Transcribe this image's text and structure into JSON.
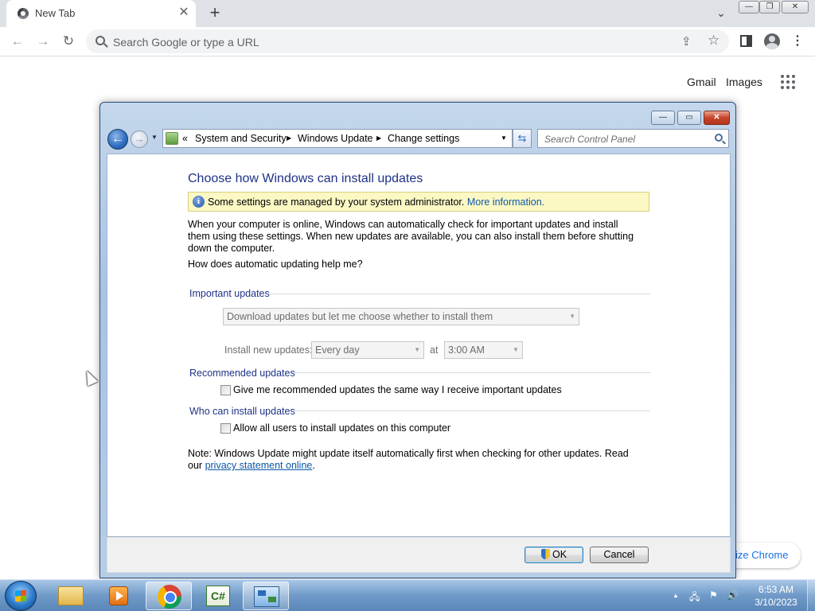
{
  "browser": {
    "tab_title": "New Tab",
    "tab_close": "✕",
    "new_tab": "+",
    "tab_search": "⌄",
    "omnibox_placeholder": "Search Google or type a URL",
    "back": "←",
    "forward": "→",
    "reload": "↻",
    "share": "⇪",
    "star": "☆",
    "menu": "⋮",
    "window_minimize": "—",
    "window_restore": "❐",
    "window_close": "✕"
  },
  "ntp": {
    "gmail": "Gmail",
    "images": "Images",
    "customize": "ize Chrome"
  },
  "dialog": {
    "controls": {
      "minimize": "—",
      "maximize": "▭",
      "close": "✕"
    },
    "breadcrumb": {
      "prefix": "«",
      "items": [
        "System and Security",
        "Windows Update",
        "Change settings"
      ]
    },
    "search_placeholder": "Search Control Panel",
    "refresh": "⇆",
    "heading": "Choose how Windows can install updates",
    "info": {
      "icon": "i",
      "text": "Some settings are managed by your system administrator.",
      "link": "More information."
    },
    "description": "When your computer is online, Windows can automatically check for important updates and install them using these settings. When new updates are available, you can also install them before shutting down the computer.",
    "help_link": "How does automatic updating help me?",
    "important": {
      "title": "Important updates",
      "selected": "Download updates but let me choose whether to install them",
      "install_label": "Install new updates:",
      "day": "Every day",
      "at": "at",
      "time": "3:00 AM"
    },
    "recommended": {
      "title": "Recommended updates",
      "checkbox_label": "Give me recommended updates the same way I receive important updates"
    },
    "who": {
      "title": "Who can install updates",
      "checkbox_label": "Allow all users to install updates on this computer"
    },
    "note": "Note: Windows Update might update itself automatically first when checking for other updates.  Read our",
    "privacy_link": "privacy statement online",
    "privacy_suffix": ".",
    "ok": "OK",
    "cancel": "Cancel"
  },
  "taskbar": {
    "csharp_label": "C#",
    "tray_arrow": "▲",
    "tray_flag": "⚑",
    "tray_volume": "🔊",
    "tray_network": "🖧",
    "time": "6:53 AM",
    "date": "3/10/2023"
  }
}
